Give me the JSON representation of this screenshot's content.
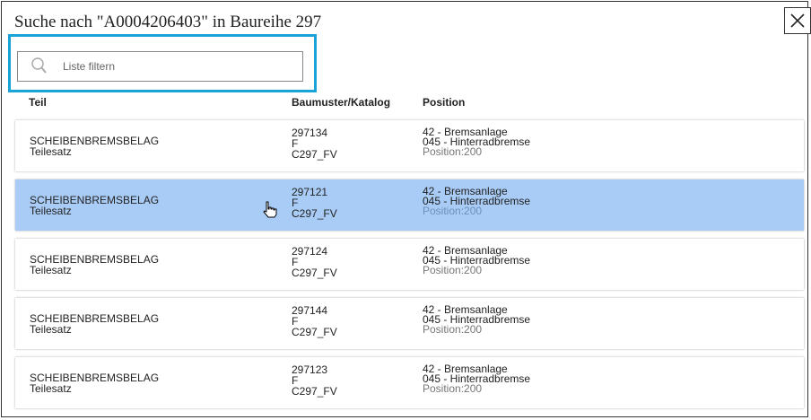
{
  "dialog": {
    "title": "Suche nach \"A0004206403\" in Baureihe 297",
    "close_icon": "close-icon"
  },
  "filter": {
    "placeholder": "Liste filtern",
    "value": "",
    "icon": "search-icon"
  },
  "colors": {
    "highlight_border": "#1aa3d6",
    "selected_row": "#a9ccf6"
  },
  "columns": {
    "part": "Teil",
    "model": "Baumuster/Katalog",
    "position": "Position"
  },
  "rows": [
    {
      "part": "SCHEIBENBREMSBELAG",
      "part_sub": "Teilesatz",
      "model": "297134",
      "variant": "F",
      "catalog": "C297_FV",
      "group": "42 - Bremsanlage",
      "subgroup": "045 - Hinterradbremse",
      "position": "Position:200"
    },
    {
      "part": "SCHEIBENBREMSBELAG",
      "part_sub": "Teilesatz",
      "model": "297121",
      "variant": "F",
      "catalog": "C297_FV",
      "group": "42 - Bremsanlage",
      "subgroup": "045 - Hinterradbremse",
      "position": "Position:200"
    },
    {
      "part": "SCHEIBENBREMSBELAG",
      "part_sub": "Teilesatz",
      "model": "297124",
      "variant": "F",
      "catalog": "C297_FV",
      "group": "42 - Bremsanlage",
      "subgroup": "045 - Hinterradbremse",
      "position": "Position:200"
    },
    {
      "part": "SCHEIBENBREMSBELAG",
      "part_sub": "Teilesatz",
      "model": "297144",
      "variant": "F",
      "catalog": "C297_FV",
      "group": "42 - Bremsanlage",
      "subgroup": "045 - Hinterradbremse",
      "position": "Position:200"
    },
    {
      "part": "SCHEIBENBREMSBELAG",
      "part_sub": "Teilesatz",
      "model": "297123",
      "variant": "F",
      "catalog": "C297_FV",
      "group": "42 - Bremsanlage",
      "subgroup": "045 - Hinterradbremse",
      "position": "Position:200"
    }
  ]
}
